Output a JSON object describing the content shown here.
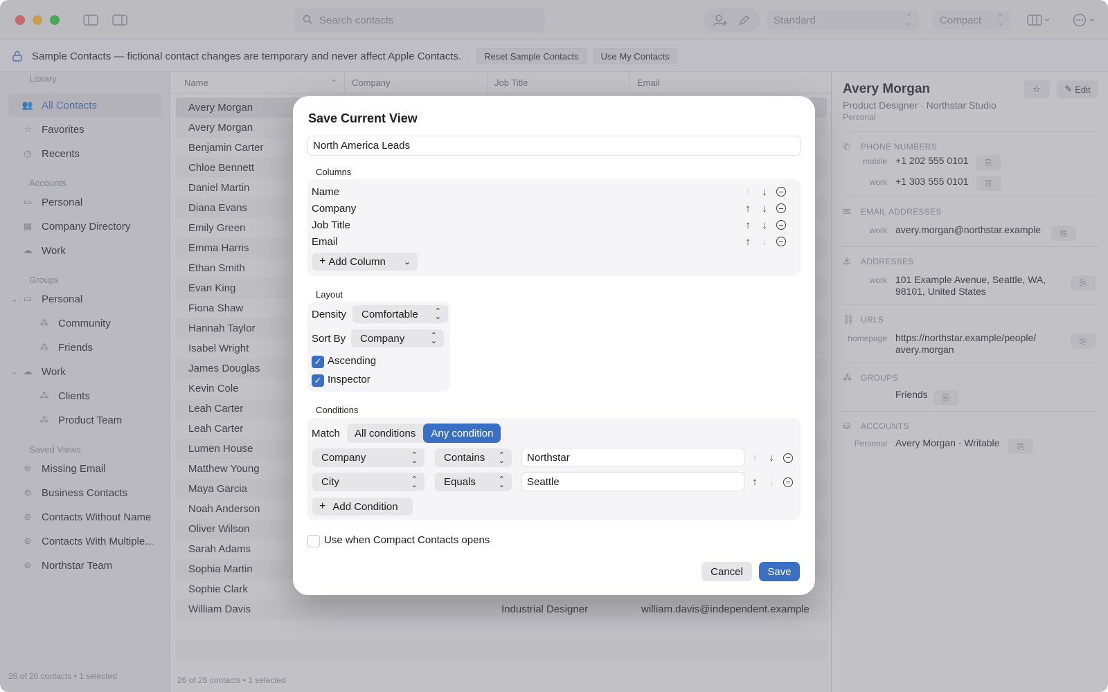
{
  "toolbar": {
    "search_placeholder": "Search contacts",
    "style_select": "Standard",
    "density_select": "Compact"
  },
  "banner": {
    "text": "Sample Contacts — fictional contact changes are temporary and never affect Apple Contacts.",
    "reset_button": "Reset Sample Contacts",
    "use_my_button": "Use My Contacts"
  },
  "sidebar": {
    "library_label": "Library",
    "library": [
      {
        "label": "All Contacts",
        "icon": "people-icon"
      },
      {
        "label": "Favorites",
        "icon": "star-icon"
      },
      {
        "label": "Recents",
        "icon": "clock-icon"
      }
    ],
    "accounts_label": "Accounts",
    "accounts": [
      {
        "label": "Personal",
        "icon": "laptop-icon"
      },
      {
        "label": "Company Directory",
        "icon": "building-icon"
      },
      {
        "label": "Work",
        "icon": "cloud-icon"
      }
    ],
    "groups_label": "Groups",
    "groups": [
      {
        "label": "Personal"
      },
      {
        "label": "Community"
      },
      {
        "label": "Friends"
      },
      {
        "label": "Work"
      },
      {
        "label": "Clients"
      },
      {
        "label": "Product Team"
      }
    ],
    "saved_label": "Saved Views",
    "saved": [
      {
        "label": "Missing Email"
      },
      {
        "label": "Business Contacts"
      },
      {
        "label": "Contacts Without Name"
      },
      {
        "label": "Contacts With Multiple..."
      },
      {
        "label": "Northstar Team"
      }
    ],
    "footer": "26 of 26 contacts • 1 selected"
  },
  "table": {
    "columns": [
      "Name",
      "Company",
      "Job Title",
      "Email"
    ],
    "rows": [
      {
        "name": "Avery Morgan"
      },
      {
        "name": "Avery Morgan"
      },
      {
        "name": "Benjamin Carter"
      },
      {
        "name": "Chloe Bennett"
      },
      {
        "name": "Daniel Martin"
      },
      {
        "name": "Diana Evans"
      },
      {
        "name": "Emily Green"
      },
      {
        "name": "Emma Harris"
      },
      {
        "name": "Ethan Smith"
      },
      {
        "name": "Evan King"
      },
      {
        "name": "Fiona Shaw"
      },
      {
        "name": "Hannah Taylor"
      },
      {
        "name": "Isabel Wright"
      },
      {
        "name": "James Douglas"
      },
      {
        "name": "Kevin Cole"
      },
      {
        "name": "Leah Carter"
      },
      {
        "name": "Leah Carter"
      },
      {
        "name": "Lumen House"
      },
      {
        "name": "Matthew Young"
      },
      {
        "name": "Maya Garcia"
      },
      {
        "name": "Noah Anderson"
      },
      {
        "name": "Oliver Wilson"
      },
      {
        "name": "Sarah Adams"
      },
      {
        "name": "Sophia Martin"
      },
      {
        "name": "Sophie Clark"
      },
      {
        "name": "William Davis",
        "job": "Industrial Designer",
        "email": "william.davis@independent.example"
      }
    ],
    "footer": "26 of 26 contacts • 1 selected"
  },
  "inspector": {
    "name": "Avery Morgan",
    "subtitle": "Product Designer · Northstar Studio",
    "account": "Personal",
    "edit_label": "Edit",
    "phones_header": "PHONE NUMBERS",
    "phones": [
      {
        "label": "mobile",
        "value": "+1 202 555 0101"
      },
      {
        "label": "work",
        "value": "+1 303 555 0101"
      }
    ],
    "emails_header": "EMAIL ADDRESSES",
    "email": {
      "label": "work",
      "value": "avery.morgan@northstar.example"
    },
    "addresses_header": "ADDRESSES",
    "address": {
      "label": "work",
      "line1": "101 Example Avenue, Seattle, WA,",
      "line2": "98101, United States"
    },
    "urls_header": "URLS",
    "url": {
      "label": "homepage",
      "line1": "https://northstar.example/people/",
      "line2": "avery.morgan"
    },
    "groups_header": "GROUPS",
    "group_value": "Friends",
    "accounts_header": "ACCOUNTS",
    "account_row": {
      "label": "Personal",
      "value": "Avery Morgan · Writable"
    }
  },
  "dialog": {
    "title": "Save Current View",
    "view_name": "North America Leads",
    "columns_label": "Columns",
    "columns": [
      {
        "label": "Name",
        "up_enabled": false,
        "down_enabled": true
      },
      {
        "label": "Company",
        "up_enabled": true,
        "down_enabled": true
      },
      {
        "label": "Job Title",
        "up_enabled": true,
        "down_enabled": true
      },
      {
        "label": "Email",
        "up_enabled": true,
        "down_enabled": false
      }
    ],
    "add_column": "Add Column",
    "layout_label": "Layout",
    "density_label": "Density",
    "density_value": "Comfortable",
    "sort_label": "Sort By",
    "sort_value": "Company",
    "ascending_label": "Ascending",
    "ascending_checked": true,
    "inspector_label": "Inspector",
    "inspector_checked": true,
    "conditions_label": "Conditions",
    "match_label": "Match",
    "match_all": "All conditions",
    "match_any": "Any condition",
    "match_selected": "any",
    "conditions": [
      {
        "field": "Company",
        "op": "Contains",
        "value": "Northstar"
      },
      {
        "field": "City",
        "op": "Equals",
        "value": "Seattle"
      }
    ],
    "add_condition": "Add Condition",
    "use_on_open_label": "Use when Compact Contacts opens",
    "use_on_open_checked": false,
    "cancel": "Cancel",
    "save": "Save"
  },
  "colors": {
    "accent": "#3a6fc4",
    "close": "#ff5f57",
    "minimize": "#febc2e",
    "maximize": "#28c840"
  }
}
